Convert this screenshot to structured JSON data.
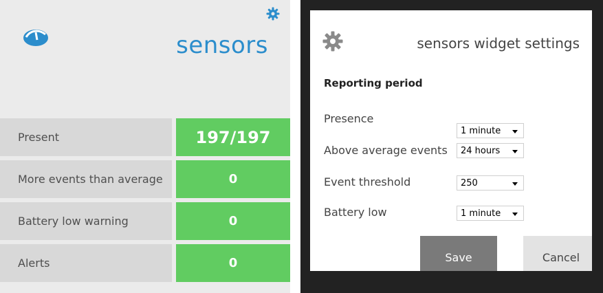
{
  "widget": {
    "title": "sensors",
    "rows": [
      {
        "label": "Present",
        "value": "197/197"
      },
      {
        "label": "More events than average",
        "value": "0"
      },
      {
        "label": "Battery low warning",
        "value": "0"
      },
      {
        "label": "Alerts",
        "value": "0"
      }
    ]
  },
  "dialog": {
    "title": "sensors widget settings",
    "section_label": "Reporting period",
    "fields": [
      {
        "label": "Presence",
        "value": "1 minute"
      },
      {
        "label": "Above average events",
        "value": "24 hours"
      },
      {
        "label": "Event threshold",
        "value": "250"
      },
      {
        "label": "Battery low",
        "value": "1 minute"
      }
    ],
    "save_label": "Save",
    "cancel_label": "Cancel"
  },
  "colors": {
    "accent_blue": "#2b8dcc",
    "value_green": "#61cc61",
    "label_grey": "#d8d8d8",
    "panel_grey": "#ebebeb"
  },
  "icons": [
    "logo-icon",
    "gear-icon",
    "settings-gear-icon",
    "dropdown-caret-icon"
  ]
}
